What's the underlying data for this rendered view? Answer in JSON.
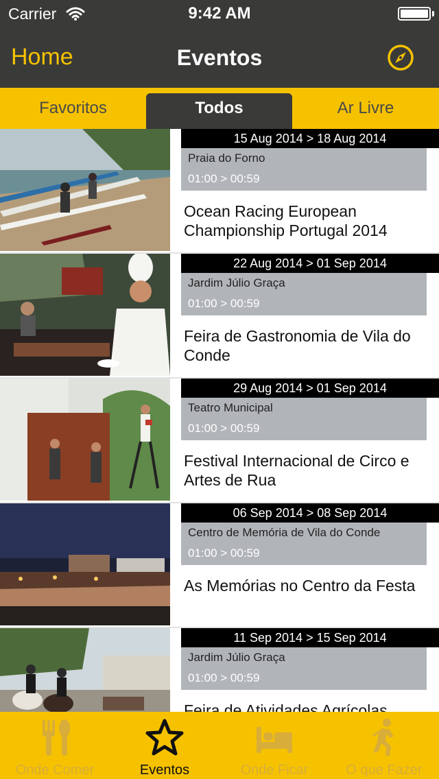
{
  "status_bar": {
    "carrier": "Carrier",
    "time": "9:42 AM"
  },
  "nav": {
    "back_label": "Home",
    "title": "Eventos",
    "right_icon": "compass-icon"
  },
  "segments": [
    {
      "label": "Favoritos",
      "selected": false
    },
    {
      "label": "Todos",
      "selected": true
    },
    {
      "label": "Ar Livre",
      "selected": false
    }
  ],
  "events": [
    {
      "date": "15 Aug 2014 > 18 Aug 2014",
      "place": "Praia do Forno",
      "time": "01:00 > 00:59",
      "title": "Ocean Racing European Championship Portugal 2014",
      "image": "kayaks-on-beach"
    },
    {
      "date": "22 Aug 2014 > 01 Sep 2014",
      "place": "Jardim Júlio Graça",
      "time": "01:00 > 00:59",
      "title": "Feira de Gastronomia de Vila do Conde",
      "image": "chef-at-grill"
    },
    {
      "date": "29 Aug 2014 > 01 Sep 2014",
      "place": "Teatro Municipal",
      "time": "01:00 > 00:59",
      "title": "Festival Internacional de Circo e Artes de Rua",
      "image": "street-performers"
    },
    {
      "date": "06 Sep 2014 > 08 Sep 2014",
      "place": "Centro de Memória de Vila do Conde",
      "time": "01:00 > 00:59",
      "title": "As Memórias no Centro da Festa",
      "image": "night-crowd"
    },
    {
      "date": "11 Sep 2014 > 15 Sep 2014",
      "place": "Jardim Júlio Graça",
      "time": "01:00 > 00:59",
      "title": "Feira de Atividades Agrícolas",
      "image": "horse-parade"
    }
  ],
  "tab_bar": [
    {
      "label": "Onde Comer",
      "icon": "fork-spoon-icon",
      "active": false
    },
    {
      "label": "Eventos",
      "icon": "star-icon",
      "active": true
    },
    {
      "label": "Onde Ficar",
      "icon": "bed-icon",
      "active": false
    },
    {
      "label": "O que Fazer",
      "icon": "running-person-icon",
      "active": false
    }
  ],
  "colors": {
    "accent": "#f6c200",
    "header": "#3a3a38",
    "info_box": "#b1b5b9"
  }
}
